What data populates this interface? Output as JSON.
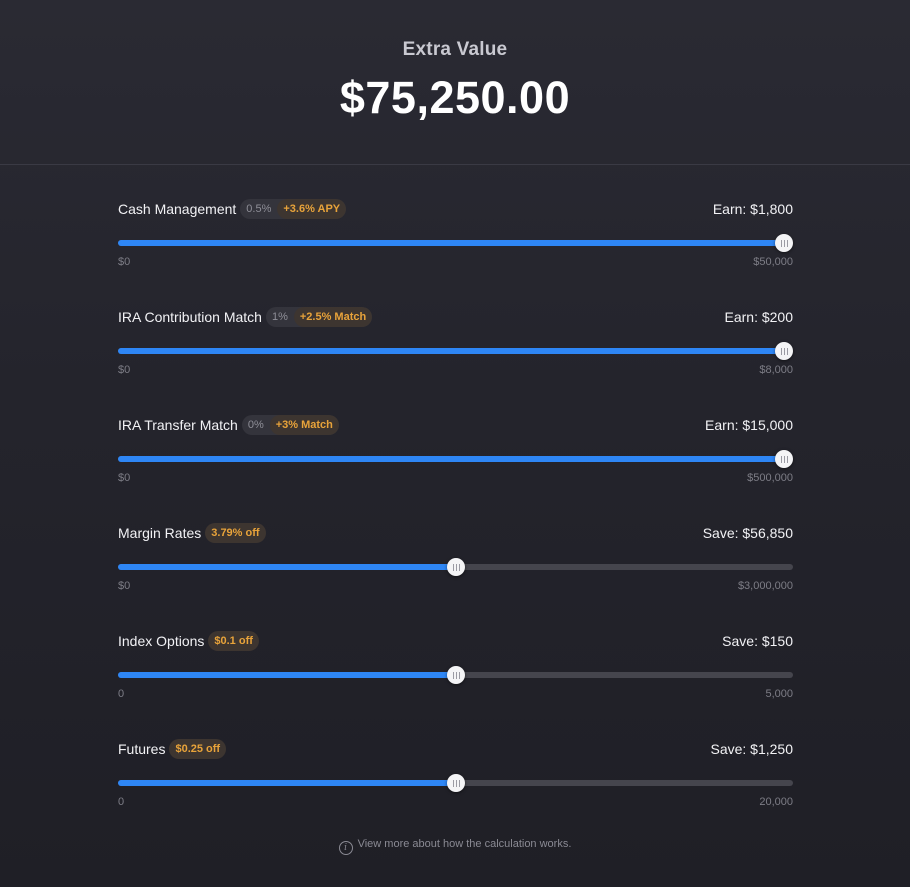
{
  "header": {
    "title": "Extra Value",
    "amount": "$75,250.00"
  },
  "rows": [
    {
      "label": "Cash Management",
      "base_rate": "0.5%",
      "promo": "+3.6% APY",
      "earn": "Earn: $1,800",
      "min": "$0",
      "max": "$50,000",
      "fraction": 1.0
    },
    {
      "label": "IRA Contribution Match",
      "base_rate": "1%",
      "promo": "+2.5% Match",
      "earn": "Earn: $200",
      "min": "$0",
      "max": "$8,000",
      "fraction": 1.0
    },
    {
      "label": "IRA Transfer Match",
      "base_rate": "0%",
      "promo": "+3% Match",
      "earn": "Earn: $15,000",
      "min": "$0",
      "max": "$500,000",
      "fraction": 1.0
    },
    {
      "label": "Margin Rates",
      "base_rate": "",
      "promo": "3.79% off",
      "earn": "Save: $56,850",
      "min": "$0",
      "max": "$3,000,000",
      "fraction": 0.5
    },
    {
      "label": "Index Options",
      "base_rate": "",
      "promo": "$0.1 off",
      "earn": "Save: $150",
      "min": "0",
      "max": "5,000",
      "fraction": 0.5
    },
    {
      "label": "Futures",
      "base_rate": "",
      "promo": "$0.25 off",
      "earn": "Save: $1,250",
      "min": "0",
      "max": "20,000",
      "fraction": 0.5
    }
  ],
  "footer": {
    "icon": "info-icon",
    "link_text": "View more about how the calculation works."
  },
  "colors": {
    "accent": "#2e86f5",
    "promo": "#e8a33a",
    "track": "#45454d"
  }
}
